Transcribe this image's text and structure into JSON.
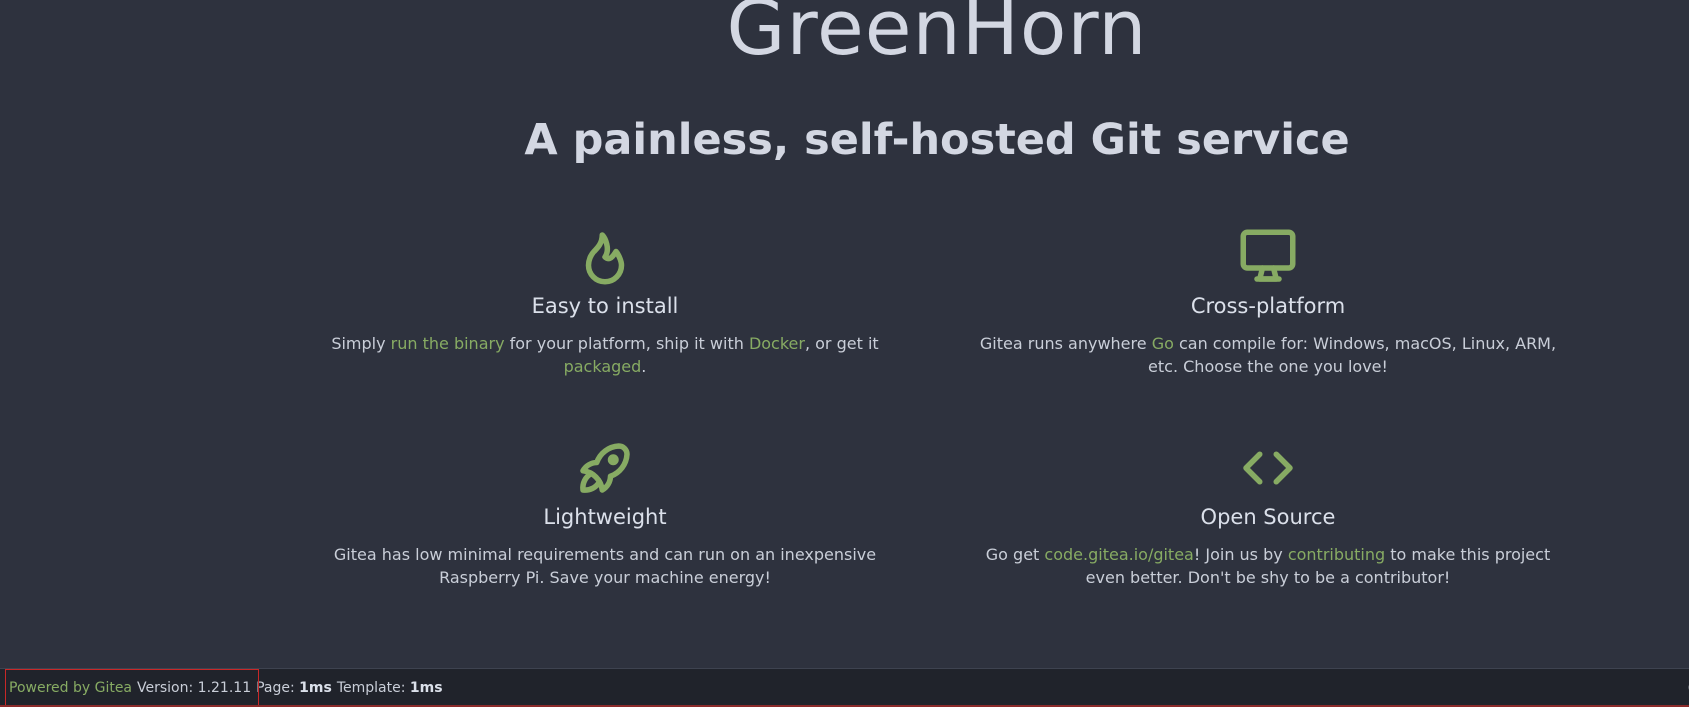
{
  "hero": {
    "title": "GreenHorn",
    "subtitle": "A painless, self-hosted Git service"
  },
  "features": {
    "install": {
      "icon": "flame-icon",
      "title": "Easy to install",
      "text_1": "Simply ",
      "link_1": "run the binary",
      "text_2": " for your platform, ship it with ",
      "link_2": "Docker",
      "text_3": ", or get it ",
      "link_3": "packaged",
      "text_4": "."
    },
    "cross": {
      "icon": "monitor-icon",
      "title": "Cross-platform",
      "text_1": "Gitea runs anywhere ",
      "link_1": "Go",
      "text_2": " can compile for: Windows, macOS, Linux, ARM, etc. Choose the one you love!"
    },
    "light": {
      "icon": "rocket-icon",
      "title": "Lightweight",
      "text": "Gitea has low minimal requirements and can run on an inexpensive Raspberry Pi. Save your machine energy!"
    },
    "open": {
      "icon": "code-icon",
      "title": "Open Source",
      "text_1": "Go get ",
      "link_1": "code.gitea.io/gitea",
      "text_2": "! Join us by ",
      "link_2": "contributing",
      "text_3": " to make this project even better. Don't be shy to be a contributor!"
    }
  },
  "footer": {
    "powered_by": "Powered by Gitea",
    "version_label": "Version:",
    "version": "1.21.11",
    "page_label": "Page:",
    "page_time": "1ms",
    "template_label": "Template:",
    "template_time": "1ms",
    "edge_text": "("
  },
  "colors": {
    "background": "#2e323e",
    "accent": "#87ab63",
    "text": "#dbe0ea",
    "footer_bg": "#20232b",
    "highlight_box": "#c82828"
  }
}
